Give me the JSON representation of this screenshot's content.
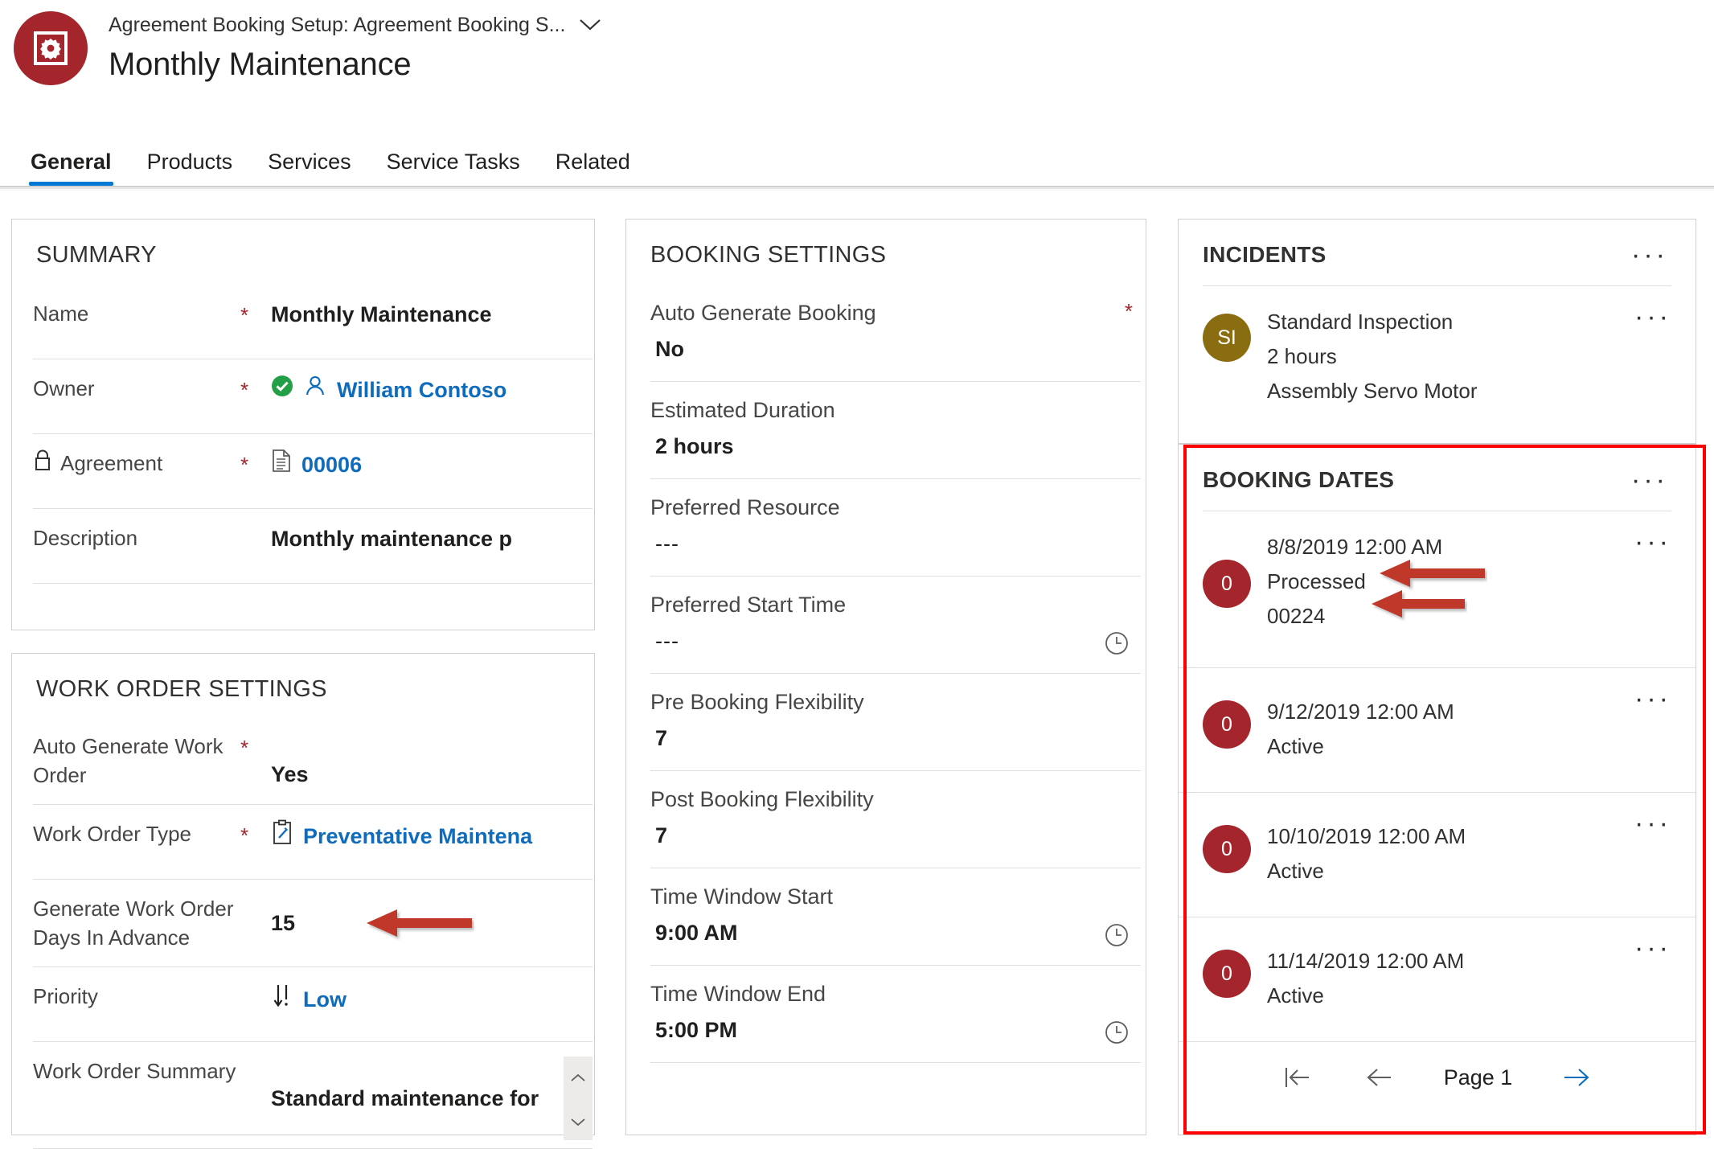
{
  "header": {
    "breadcrumb": "Agreement Booking Setup: Agreement Booking S...",
    "title": "Monthly Maintenance",
    "avatar_color": "#a4262c",
    "entity_icon": "agreement-booking-setup-icon",
    "chevron_icon": "chevron-down-icon"
  },
  "tabs": [
    {
      "label": "General",
      "active": true
    },
    {
      "label": "Products",
      "active": false
    },
    {
      "label": "Services",
      "active": false
    },
    {
      "label": "Service Tasks",
      "active": false
    },
    {
      "label": "Related",
      "active": false
    }
  ],
  "summary": {
    "title": "SUMMARY",
    "fields": [
      {
        "label": "Name",
        "required": "*",
        "value": "Monthly Maintenance",
        "type": "text"
      },
      {
        "label": "Owner",
        "required": "*",
        "value": "William Contoso",
        "type": "user-link"
      },
      {
        "label": "Agreement",
        "required": "*",
        "value": "00006",
        "type": "record-link",
        "locked": true
      },
      {
        "label": "Description",
        "required": "",
        "value": "Monthly maintenance p",
        "type": "text"
      }
    ]
  },
  "work_order_settings": {
    "title": "WORK ORDER SETTINGS",
    "fields": [
      {
        "label": "Auto Generate Work Order",
        "required": "*",
        "value": "Yes",
        "type": "text"
      },
      {
        "label": "Work Order Type",
        "required": "*",
        "value": "Preventative Maintena",
        "type": "record-link"
      },
      {
        "label": "Generate Work Order Days In Advance",
        "required": "",
        "value": "15",
        "type": "text"
      },
      {
        "label": "Priority",
        "required": "",
        "value": "Low",
        "type": "priority-link"
      },
      {
        "label": "Work Order Summary",
        "required": "",
        "value": "Standard maintenance for",
        "type": "textarea"
      }
    ]
  },
  "booking_settings": {
    "title": "BOOKING SETTINGS",
    "fields": [
      {
        "label": "Auto Generate Booking",
        "required": "*",
        "value": "No",
        "clock": false
      },
      {
        "label": "Estimated Duration",
        "required": "",
        "value": "2 hours",
        "clock": false
      },
      {
        "label": "Preferred Resource",
        "required": "",
        "value": "---",
        "clock": false
      },
      {
        "label": "Preferred Start Time",
        "required": "",
        "value": "---",
        "clock": true
      },
      {
        "label": "Pre Booking Flexibility",
        "required": "",
        "value": "7",
        "clock": false
      },
      {
        "label": "Post Booking Flexibility",
        "required": "",
        "value": "7",
        "clock": false
      },
      {
        "label": "Time Window Start",
        "required": "",
        "value": "9:00 AM",
        "clock": true
      },
      {
        "label": "Time Window End",
        "required": "",
        "value": "5:00 PM",
        "clock": true
      }
    ]
  },
  "incidents": {
    "title": "INCIDENTS",
    "more_icon": "ellipsis-icon",
    "items": [
      {
        "initials": "SI",
        "avatar_color": "#8a6d10",
        "line1": "Standard Inspection",
        "line2": "2 hours",
        "line3": "Assembly Servo Motor"
      }
    ]
  },
  "booking_dates": {
    "title": "BOOKING DATES",
    "more_icon": "ellipsis-icon",
    "highlighted": true,
    "items": [
      {
        "badge": "0",
        "avatar_color": "#a4262c",
        "line1": "8/8/2019 12:00 AM",
        "line2": "Processed",
        "line3": "00224"
      },
      {
        "badge": "0",
        "avatar_color": "#a4262c",
        "line1": "9/12/2019 12:00 AM",
        "line2": "Active",
        "line3": ""
      },
      {
        "badge": "0",
        "avatar_color": "#a4262c",
        "line1": "10/10/2019 12:00 AM",
        "line2": "Active",
        "line3": ""
      },
      {
        "badge": "0",
        "avatar_color": "#a4262c",
        "line1": "11/14/2019 12:00 AM",
        "line2": "Active",
        "line3": ""
      }
    ],
    "pager": {
      "first_icon": "first-page-icon",
      "prev_icon": "previous-page-icon",
      "label": "Page 1",
      "next_icon": "next-page-icon"
    }
  },
  "annotations": {
    "highlight_color": "#ff0000",
    "arrow_color": "#c0392b",
    "arrows": [
      {
        "target": "generate-work-order-days-in-advance-value"
      },
      {
        "target": "booking-date-status-processed"
      },
      {
        "target": "booking-date-number-00224"
      }
    ]
  }
}
